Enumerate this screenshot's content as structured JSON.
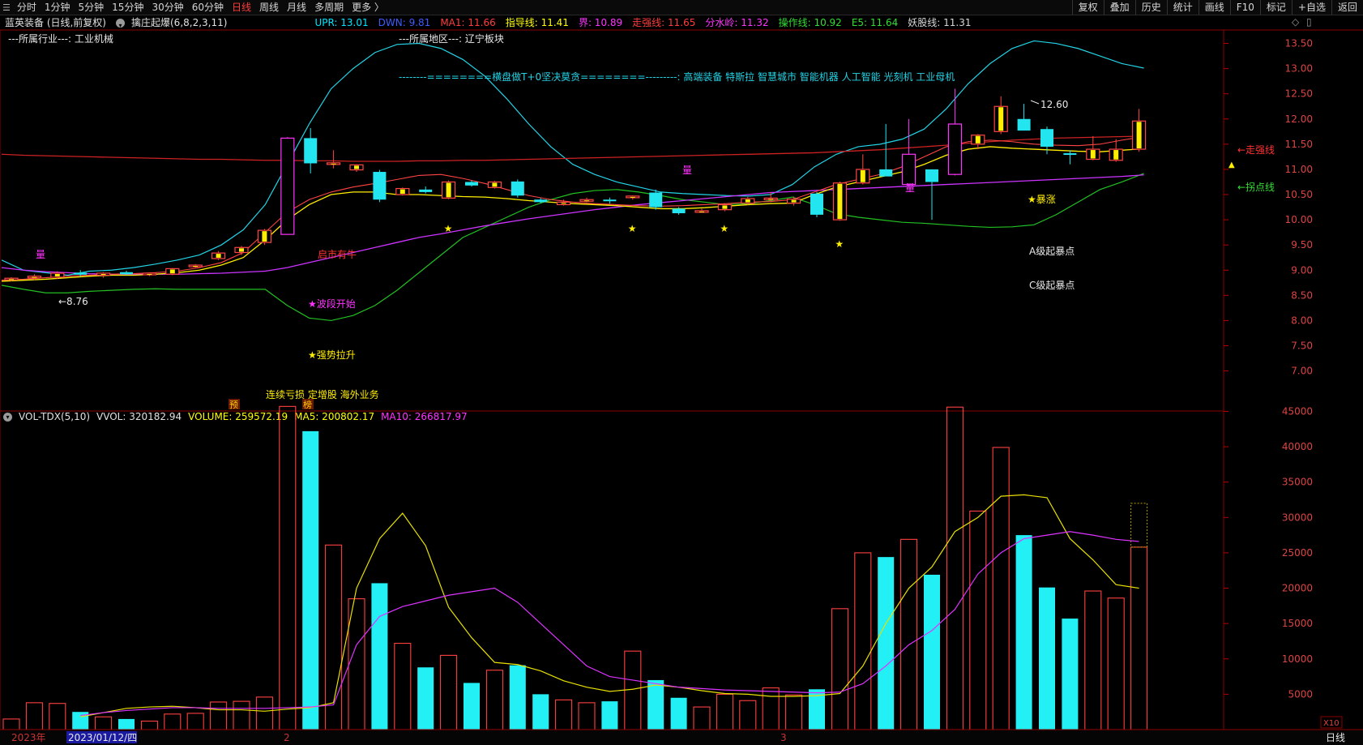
{
  "toolbar": {
    "periods": [
      "分时",
      "1分钟",
      "5分钟",
      "15分钟",
      "30分钟",
      "60分钟",
      "日线",
      "周线",
      "月线",
      "多周期",
      "更多 〉"
    ],
    "active_period": "日线",
    "right_buttons": [
      "复权",
      "叠加",
      "历史",
      "统计",
      "画线",
      "F10",
      "标记",
      "+自选",
      "返回"
    ]
  },
  "stock": {
    "title": "蓝英装备 (日线,前复权)",
    "indicator": "擒庄起爆(6,8,2,3,11)"
  },
  "indicators": [
    {
      "label": "UPR: 13.01",
      "color": "#00e5ff"
    },
    {
      "label": "DWN: 9.81",
      "color": "#3d5cff"
    },
    {
      "label": "MA1: 11.66",
      "color": "#ff3c3c"
    },
    {
      "label": "指导线: 11.41",
      "color": "#ffff00"
    },
    {
      "label": "界: 10.89",
      "color": "#ff33ff"
    },
    {
      "label": "走强线: 11.65",
      "color": "#ff3c3c"
    },
    {
      "label": "分水岭: 11.32",
      "color": "#ff33ff"
    },
    {
      "label": "操作线: 10.92",
      "color": "#33dd33"
    },
    {
      "label": "E5: 11.64",
      "color": "#33dd33"
    },
    {
      "label": "妖股线: 11.31",
      "color": "#d6d6d6"
    }
  ],
  "annotations": {
    "industry": "---所属行业---:  工业机械",
    "region": "---所属地区---:  辽宁板块",
    "concept": "--------========横盘做T+0坚决莫贪========---------:  高端装备 特斯拉 智慧城市 智能机器 人工智能 光刻机 工业母机",
    "bull": "启市有牛",
    "wave_start": "★波段开始",
    "strong_pull": "★强势拉升",
    "surge": "★暴涨",
    "a_level": "A级起暴点",
    "c_level": "C级起暴点",
    "strong_line": "←走强线",
    "buy_line": "←拐点线",
    "low_label": "←8.76",
    "high_label": "12.60",
    "liang": "量",
    "tags": "连续亏损 定增股 海外业务",
    "yu": "预",
    "bang": "榜"
  },
  "volume_info": {
    "name": "VOL-TDX(5,10)",
    "vvol": "VVOL: 320182.94",
    "volume": "VOLUME: 259572.19",
    "ma5": "MA5: 200802.17",
    "ma10": "MA10: 266817.97"
  },
  "axis": {
    "price_ticks": [
      "13.50",
      "13.00",
      "12.50",
      "12.00",
      "11.50",
      "11.00",
      "10.50",
      "10.00",
      "9.50",
      "9.00",
      "8.50",
      "8.00",
      "7.50",
      "7.00"
    ],
    "volume_ticks": [
      "45000",
      "40000",
      "35000",
      "30000",
      "25000",
      "20000",
      "15000",
      "10000",
      "5000"
    ],
    "vol_unit": "X10",
    "date_labels": [
      "2023年",
      "2023/01/12/四",
      "2",
      "3"
    ],
    "period_label": "日线"
  },
  "chart_data": {
    "type": "candlestick",
    "price_range": [
      6.8,
      13.75
    ],
    "volume_range": [
      0,
      47000
    ],
    "candles": [
      {
        "o": 8.82,
        "h": 8.86,
        "l": 8.78,
        "c": 8.84,
        "v": 1500
      },
      {
        "o": 8.85,
        "h": 8.92,
        "l": 8.8,
        "c": 8.88,
        "v": 3800
      },
      {
        "o": 8.86,
        "h": 8.98,
        "l": 8.82,
        "c": 8.94,
        "v": 3700
      },
      {
        "o": 8.95,
        "h": 9.0,
        "l": 8.88,
        "c": 8.91,
        "v": 2500
      },
      {
        "o": 8.9,
        "h": 8.96,
        "l": 8.85,
        "c": 8.94,
        "v": 1800
      },
      {
        "o": 8.96,
        "h": 8.99,
        "l": 8.9,
        "c": 8.92,
        "v": 1500
      },
      {
        "o": 8.92,
        "h": 8.95,
        "l": 8.88,
        "c": 8.94,
        "v": 1200
      },
      {
        "o": 8.92,
        "h": 9.04,
        "l": 8.9,
        "c": 9.03,
        "v": 2200
      },
      {
        "o": 9.08,
        "h": 9.12,
        "l": 9.05,
        "c": 9.1,
        "v": 2300
      },
      {
        "o": 9.23,
        "h": 9.38,
        "l": 9.2,
        "c": 9.34,
        "v": 3900
      },
      {
        "o": 9.35,
        "h": 9.48,
        "l": 9.3,
        "c": 9.45,
        "v": 4000
      },
      {
        "o": 9.55,
        "h": 9.82,
        "l": 9.5,
        "c": 9.79,
        "v": 4600
      },
      {
        "o": 9.71,
        "h": 11.64,
        "l": 9.71,
        "c": 11.62,
        "v": 45700
      },
      {
        "o": 11.62,
        "h": 11.82,
        "l": 10.92,
        "c": 11.12,
        "v": 42200
      },
      {
        "o": 11.12,
        "h": 11.38,
        "l": 11.02,
        "c": 11.13,
        "v": 26100
      },
      {
        "o": 10.99,
        "h": 11.1,
        "l": 10.95,
        "c": 11.09,
        "v": 18500
      },
      {
        "o": 10.95,
        "h": 10.99,
        "l": 10.35,
        "c": 10.4,
        "v": 20700
      },
      {
        "o": 10.5,
        "h": 10.64,
        "l": 10.48,
        "c": 10.62,
        "v": 12200
      },
      {
        "o": 10.6,
        "h": 10.66,
        "l": 10.52,
        "c": 10.55,
        "v": 8800
      },
      {
        "o": 10.43,
        "h": 10.78,
        "l": 10.41,
        "c": 10.75,
        "v": 10500
      },
      {
        "o": 10.75,
        "h": 10.78,
        "l": 10.66,
        "c": 10.68,
        "v": 6600
      },
      {
        "o": 10.64,
        "h": 10.77,
        "l": 10.62,
        "c": 10.75,
        "v": 8400
      },
      {
        "o": 10.76,
        "h": 10.8,
        "l": 10.44,
        "c": 10.48,
        "v": 9100
      },
      {
        "o": 10.4,
        "h": 10.43,
        "l": 10.33,
        "c": 10.35,
        "v": 5000
      },
      {
        "o": 10.3,
        "h": 10.4,
        "l": 10.28,
        "c": 10.35,
        "v": 4200
      },
      {
        "o": 10.37,
        "h": 10.44,
        "l": 10.35,
        "c": 10.4,
        "v": 3800
      },
      {
        "o": 10.4,
        "h": 10.44,
        "l": 10.32,
        "c": 10.39,
        "v": 4000
      },
      {
        "o": 10.44,
        "h": 10.48,
        "l": 10.4,
        "c": 10.47,
        "v": 11100
      },
      {
        "o": 10.54,
        "h": 10.6,
        "l": 10.2,
        "c": 10.25,
        "v": 7000
      },
      {
        "o": 10.22,
        "h": 10.25,
        "l": 10.1,
        "c": 10.13,
        "v": 4500
      },
      {
        "o": 10.17,
        "h": 10.22,
        "l": 10.14,
        "c": 10.18,
        "v": 3200
      },
      {
        "o": 10.2,
        "h": 10.33,
        "l": 10.17,
        "c": 10.3,
        "v": 5000
      },
      {
        "o": 10.33,
        "h": 10.45,
        "l": 10.3,
        "c": 10.42,
        "v": 4100
      },
      {
        "o": 10.4,
        "h": 10.55,
        "l": 10.35,
        "c": 10.43,
        "v": 5900
      },
      {
        "o": 10.33,
        "h": 10.46,
        "l": 10.28,
        "c": 10.41,
        "v": 4900
      },
      {
        "o": 10.52,
        "h": 10.55,
        "l": 10.05,
        "c": 10.1,
        "v": 5700
      },
      {
        "o": 10.0,
        "h": 10.76,
        "l": 9.98,
        "c": 10.73,
        "v": 17100
      },
      {
        "o": 10.73,
        "h": 11.3,
        "l": 10.7,
        "c": 11.0,
        "v": 25000
      },
      {
        "o": 11.0,
        "h": 11.9,
        "l": 10.88,
        "c": 10.86,
        "v": 24400
      },
      {
        "o": 10.7,
        "h": 12.0,
        "l": 10.65,
        "c": 11.3,
        "v": 26900
      },
      {
        "o": 11.0,
        "h": 11.0,
        "l": 10.0,
        "c": 10.75,
        "v": 21900
      },
      {
        "o": 10.9,
        "h": 12.6,
        "l": 10.88,
        "c": 11.9,
        "v": 45600
      },
      {
        "o": 11.5,
        "h": 11.7,
        "l": 11.4,
        "c": 11.68,
        "v": 30900
      },
      {
        "o": 11.75,
        "h": 12.45,
        "l": 11.7,
        "c": 12.25,
        "v": 39900
      },
      {
        "o": 12.0,
        "h": 12.3,
        "l": 11.8,
        "c": 11.77,
        "v": 27500
      },
      {
        "o": 11.8,
        "h": 11.85,
        "l": 11.3,
        "c": 11.45,
        "v": 20100
      },
      {
        "o": 11.32,
        "h": 11.38,
        "l": 11.1,
        "c": 11.29,
        "v": 15700
      },
      {
        "o": 11.2,
        "h": 11.66,
        "l": 11.18,
        "c": 11.4,
        "v": 19600
      },
      {
        "o": 11.18,
        "h": 11.6,
        "l": 11.15,
        "c": 11.4,
        "v": 18600
      },
      {
        "o": 11.4,
        "h": 12.2,
        "l": 11.35,
        "c": 11.96,
        "v": 25800
      }
    ],
    "upr": [
      9.2,
      9.0,
      8.95,
      8.9,
      8.98,
      9.0,
      9.05,
      9.12,
      9.2,
      9.3,
      9.5,
      9.8,
      10.3,
      11.1,
      11.9,
      12.6,
      13.0,
      13.32,
      13.48,
      13.5,
      13.4,
      13.18,
      12.85,
      12.4,
      11.9,
      11.45,
      11.1,
      10.9,
      10.75,
      10.65,
      10.55,
      10.52,
      10.5,
      10.48,
      10.47,
      10.5,
      10.7,
      11.05,
      11.3,
      11.45,
      11.5,
      11.6,
      11.8,
      12.2,
      12.7,
      13.1,
      13.4,
      13.55,
      13.5,
      13.4,
      13.25,
      13.1,
      13.01
    ],
    "dwn": [
      8.7,
      8.62,
      8.55,
      8.55,
      8.58,
      8.6,
      8.62,
      8.63,
      8.62,
      8.62,
      8.62,
      8.62,
      8.62,
      8.3,
      8.05,
      8.0,
      8.1,
      8.3,
      8.6,
      8.95,
      9.3,
      9.65,
      9.85,
      10.05,
      10.25,
      10.4,
      10.52,
      10.58,
      10.6,
      10.55,
      10.48,
      10.4,
      10.35,
      10.3,
      10.32,
      10.38,
      10.45,
      10.3,
      10.12,
      10.05,
      10.0,
      9.95,
      9.93,
      9.9,
      9.87,
      9.85,
      9.86,
      9.9,
      10.1,
      10.35,
      10.6,
      10.75,
      10.92
    ],
    "ma1": [
      11.3,
      11.28,
      11.27,
      11.26,
      11.25,
      11.24,
      11.23,
      11.22,
      11.21,
      11.2,
      11.2,
      11.19,
      11.18,
      11.18,
      11.17,
      11.17,
      11.16,
      11.16,
      11.16,
      11.17,
      11.17,
      11.18,
      11.18,
      11.19,
      11.2,
      11.21,
      11.22,
      11.23,
      11.24,
      11.25,
      11.26,
      11.27,
      11.28,
      11.29,
      11.3,
      11.31,
      11.32,
      11.33,
      11.35,
      11.37,
      11.39,
      11.42,
      11.45,
      11.48,
      11.52,
      11.55,
      11.58,
      11.6,
      11.62,
      11.63,
      11.64,
      11.65,
      11.66
    ],
    "guide": [
      8.78,
      8.8,
      8.82,
      8.85,
      8.88,
      8.9,
      8.9,
      8.92,
      8.95,
      9.0,
      9.1,
      9.25,
      9.6,
      10.0,
      10.3,
      10.5,
      10.55,
      10.55,
      10.5,
      10.5,
      10.48,
      10.46,
      10.45,
      10.42,
      10.38,
      10.35,
      10.32,
      10.3,
      10.28,
      10.25,
      10.22,
      10.22,
      10.24,
      10.27,
      10.3,
      10.32,
      10.33,
      10.5,
      10.65,
      10.75,
      10.85,
      10.95,
      11.1,
      11.28,
      11.4,
      11.45,
      11.42,
      11.4,
      11.38,
      11.36,
      11.35,
      11.38,
      11.41
    ],
    "redfast": [
      8.8,
      8.82,
      8.85,
      8.88,
      8.9,
      8.92,
      8.93,
      8.95,
      8.98,
      9.05,
      9.15,
      9.35,
      9.75,
      10.15,
      10.4,
      10.55,
      10.65,
      10.72,
      10.8,
      10.88,
      10.9,
      10.82,
      10.72,
      10.6,
      10.48,
      10.4,
      10.35,
      10.32,
      10.3,
      10.28,
      10.27,
      10.28,
      10.3,
      10.32,
      10.35,
      10.36,
      10.4,
      10.55,
      10.7,
      10.8,
      10.9,
      11.05,
      11.25,
      11.45,
      11.55,
      11.58,
      11.55,
      11.5,
      11.48,
      11.47,
      11.5,
      11.58,
      11.65
    ],
    "jie": [
      9.05,
      9.0,
      8.97,
      8.95,
      8.93,
      8.92,
      8.92,
      8.92,
      8.92,
      8.93,
      8.94,
      8.96,
      8.98,
      9.05,
      9.15,
      9.25,
      9.35,
      9.45,
      9.55,
      9.65,
      9.72,
      9.8,
      9.88,
      9.95,
      10.02,
      10.08,
      10.14,
      10.2,
      10.25,
      10.3,
      10.34,
      10.38,
      10.42,
      10.46,
      10.5,
      10.54,
      10.56,
      10.58,
      10.6,
      10.62,
      10.64,
      10.66,
      10.68,
      10.7,
      10.72,
      10.74,
      10.76,
      10.78,
      10.8,
      10.82,
      10.84,
      10.86,
      10.89
    ],
    "vol_ma5": [
      1800,
      2400,
      3000,
      3200,
      3300,
      3100,
      2800,
      2800,
      2600,
      2900,
      3100,
      3800,
      20000,
      27000,
      30600,
      26000,
      17300,
      13000,
      9500,
      9200,
      8300,
      6900,
      6000,
      5400,
      5700,
      6300,
      6000,
      5500,
      5100,
      5000,
      4700,
      4700,
      4800,
      5100,
      9000,
      15000,
      20000,
      23000,
      28000,
      30000,
      33000,
      33200,
      32800,
      27000,
      24000,
      20500,
      20000
    ],
    "vol_ma10": [
      2000,
      2400,
      2700,
      2900,
      3100,
      3100,
      3000,
      3000,
      3000,
      3100,
      3200,
      3500,
      12000,
      16000,
      17400,
      18200,
      19000,
      19500,
      20000,
      18000,
      15000,
      12000,
      9000,
      7500,
      7000,
      6500,
      6000,
      5800,
      5600,
      5500,
      5400,
      5300,
      5200,
      5300,
      6500,
      9000,
      12000,
      14000,
      17000,
      22000,
      25000,
      27000,
      27500,
      28000,
      27500,
      26900,
      26600
    ]
  }
}
